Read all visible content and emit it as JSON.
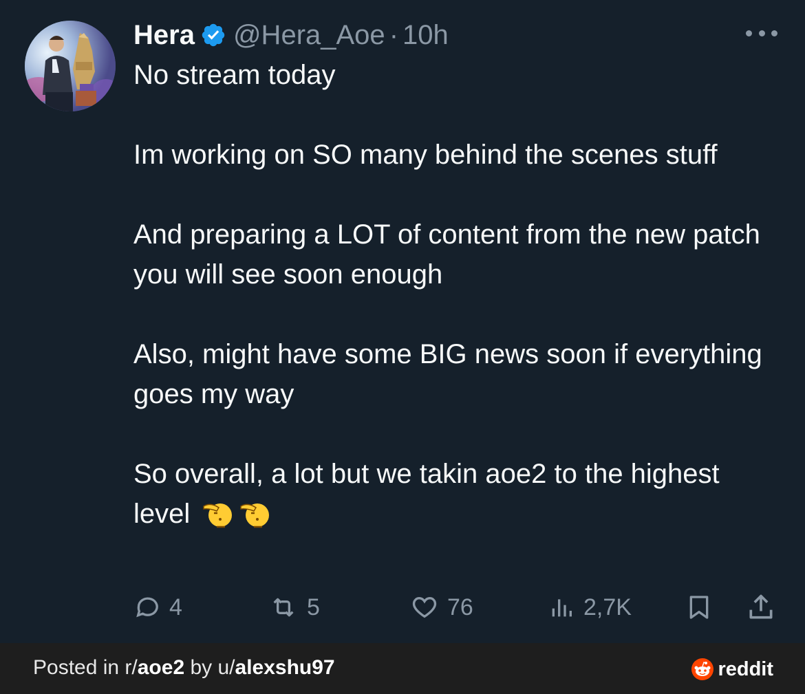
{
  "tweet": {
    "author_name": "Hera",
    "handle": "@Hera_Aoe",
    "separator": "·",
    "time": "10h",
    "paragraphs": [
      "No stream today",
      "Im working on SO many behind the scenes stuff",
      "And preparing a LOT of content from the new patch you will see soon enough",
      "Also, might have some BIG news soon if everything goes my way",
      "So overall, a lot but we takin aoe2 to the highest level"
    ],
    "emoji": "🫡🫡",
    "stats": {
      "replies": "4",
      "retweets": "5",
      "likes": "76",
      "views": "2,7K"
    }
  },
  "footer": {
    "posted_in": "Posted in r/",
    "subreddit": "aoe2",
    "by": " by u/",
    "username": "alexshu97",
    "brand": "reddit"
  },
  "colors": {
    "background": "#15202b",
    "text": "#f7f9f9",
    "muted": "#8b98a5",
    "verified": "#1d9bf0",
    "footer_bg": "#1e1e1e",
    "reddit_orange": "#ff4500"
  },
  "icons": [
    "more-icon",
    "verified-badge-icon",
    "reply-icon",
    "retweet-icon",
    "like-icon",
    "views-icon",
    "bookmark-icon",
    "share-icon",
    "reddit-logo-icon"
  ]
}
